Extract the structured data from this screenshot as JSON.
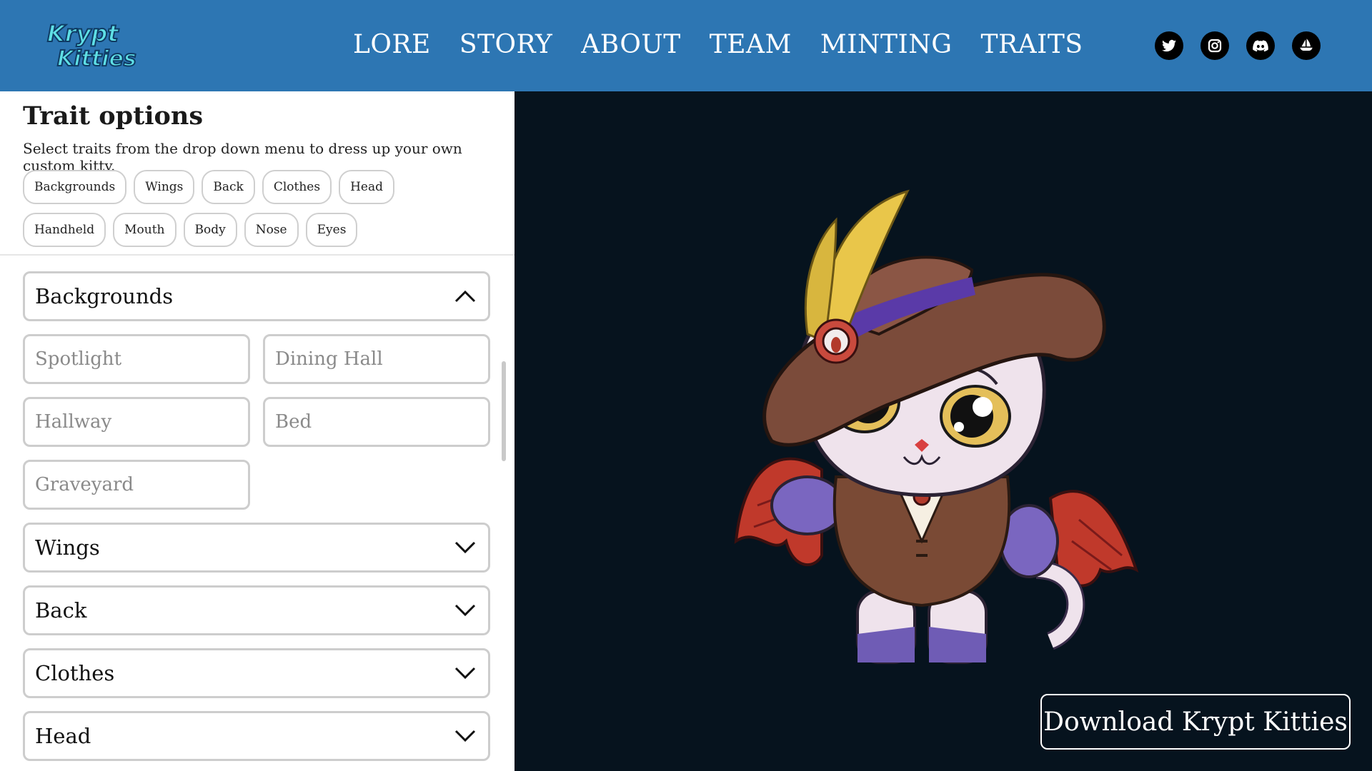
{
  "header": {
    "logo_text_1": "Krypt",
    "logo_text_2": "Kitties",
    "nav": [
      {
        "label": "LORE"
      },
      {
        "label": "STORY"
      },
      {
        "label": "ABOUT"
      },
      {
        "label": "TEAM"
      },
      {
        "label": "MINTING"
      },
      {
        "label": "TRAITS"
      }
    ],
    "socials": [
      {
        "icon": "twitter-icon"
      },
      {
        "icon": "instagram-icon"
      },
      {
        "icon": "discord-icon"
      },
      {
        "icon": "opensea-icon"
      }
    ]
  },
  "panel": {
    "title": "Trait options",
    "subtitle": "Select traits from the drop down menu to dress up your own custom kitty.",
    "chips": [
      "Backgrounds",
      "Wings",
      "Back",
      "Clothes",
      "Head",
      "Handheld",
      "Mouth",
      "Body",
      "Nose",
      "Eyes"
    ],
    "sections": [
      {
        "label": "Backgrounds",
        "expanded": true,
        "options": [
          "Spotlight",
          "Dining Hall",
          "Hallway",
          "Bed",
          "Graveyard"
        ]
      },
      {
        "label": "Wings",
        "expanded": false
      },
      {
        "label": "Back",
        "expanded": false
      },
      {
        "label": "Clothes",
        "expanded": false
      },
      {
        "label": "Head",
        "expanded": false
      }
    ]
  },
  "preview": {
    "download_label": "Download Krypt Kitties"
  },
  "colors": {
    "header_bg": "#2d76b3",
    "preview_bg": "#06131e",
    "logo_cyan": "#5fe0e6"
  }
}
